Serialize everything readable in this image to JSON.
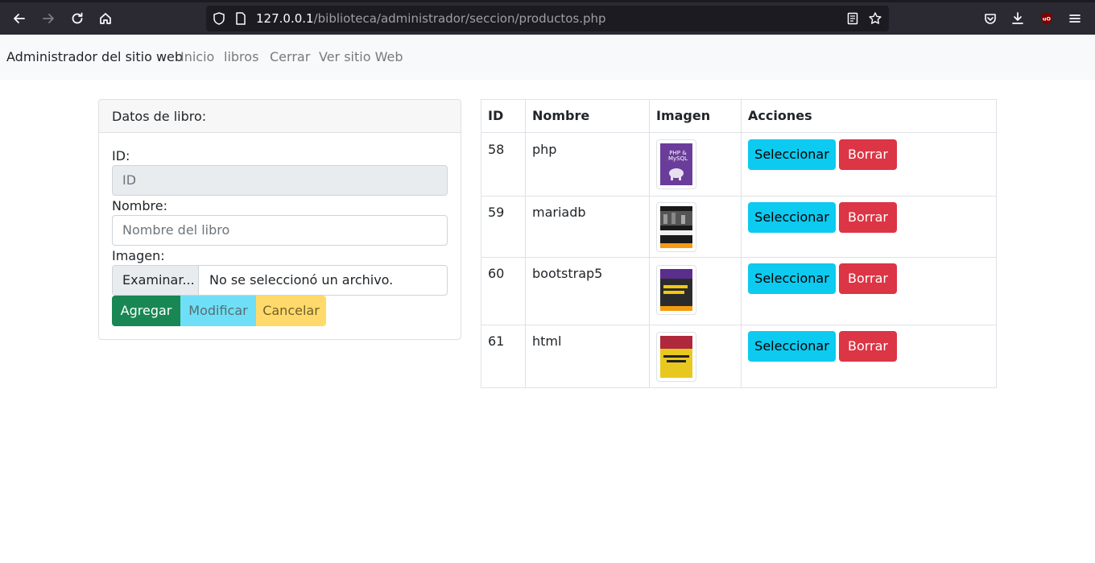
{
  "browser": {
    "url_host": "127.0.0.1",
    "url_path": "/biblioteca/administrador/seccion/productos.php"
  },
  "navbar": {
    "brand": "Administrador del sitio web",
    "links": [
      "Inicio",
      "libros",
      "Cerrar",
      "Ver sitio Web"
    ]
  },
  "form": {
    "header": "Datos de libro:",
    "id_label": "ID:",
    "id_placeholder": "ID",
    "nombre_label": "Nombre:",
    "nombre_placeholder": "Nombre del libro",
    "imagen_label": "Imagen:",
    "file_button": "Examinar...",
    "file_status": "No se seleccionó un archivo.",
    "buttons": {
      "agregar": "Agregar",
      "modificar": "Modificar",
      "cancelar": "Cancelar"
    }
  },
  "table": {
    "headers": [
      "ID",
      "Nombre",
      "Imagen",
      "Acciones"
    ],
    "rows": [
      {
        "id": "58",
        "nombre": "php",
        "cover": "php-mysql-book-cover",
        "cover_color": "#6a3d9a",
        "select": "Seleccionar",
        "delete": "Borrar"
      },
      {
        "id": "59",
        "nombre": "mariadb",
        "cover": "mastering-mariadb-book-cover",
        "cover_color": "#1a1a1a",
        "select": "Seleccionar",
        "delete": "Borrar"
      },
      {
        "id": "60",
        "nombre": "bootstrap5",
        "cover": "practical-bootstrap-book-cover",
        "cover_color": "#2b2b2b",
        "select": "Seleccionar",
        "delete": "Borrar"
      },
      {
        "id": "61",
        "nombre": "html",
        "cover": "html5-css3-book-cover",
        "cover_color": "#e8c81e",
        "select": "Seleccionar",
        "delete": "Borrar"
      }
    ]
  },
  "colors": {
    "success": "#198754",
    "info": "#0dcaf0",
    "danger": "#dc3545",
    "warning": "#ffc107"
  }
}
